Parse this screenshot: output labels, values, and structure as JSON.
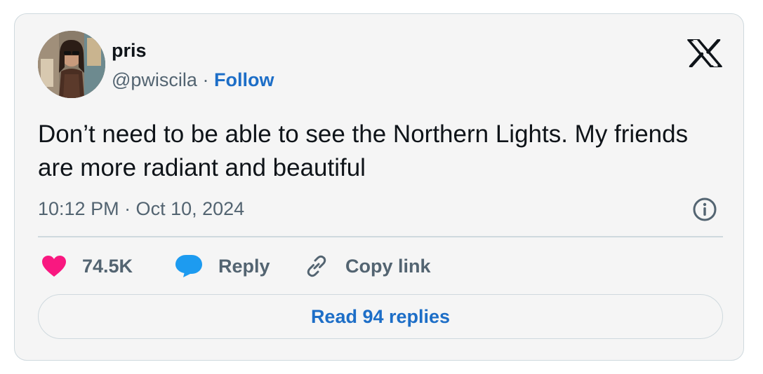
{
  "author": {
    "name": "pris",
    "handle": "@pwiscila",
    "separator": "·",
    "follow_label": "Follow"
  },
  "tweet": {
    "text": "Don’t need to be able to see the Northern Lights. My friends are more radiant and beautiful",
    "timestamp": "10:12 PM · Oct 10, 2024"
  },
  "actions": {
    "like_count": "74.5K",
    "reply_label": "Reply",
    "copy_link_label": "Copy link"
  },
  "footer": {
    "read_replies_label": "Read 94 replies"
  },
  "icons": {
    "brand": "x-logo-icon",
    "info": "info-icon",
    "like": "heart-icon",
    "reply": "speech-bubble-icon",
    "copy": "link-icon"
  },
  "colors": {
    "accent": "#1d6ec7",
    "like": "#f91880",
    "reply": "#1d9bf0",
    "muted": "#536471",
    "border": "#cfd9de",
    "card_bg": "#f5f5f5"
  }
}
